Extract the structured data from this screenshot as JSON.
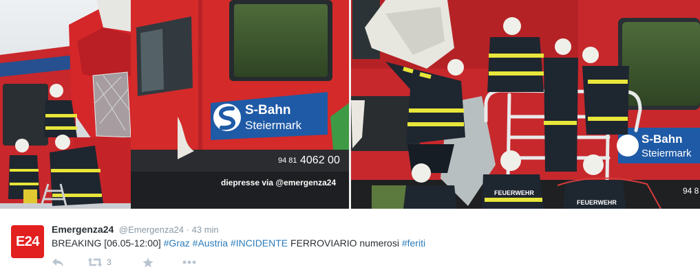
{
  "photo": {
    "left_logo": {
      "brand": "S-Bahn",
      "region": "Steiermark"
    },
    "right_logo": {
      "brand": "S-Bahn",
      "region": "Steiermark"
    },
    "train_number_prefix": "94 81",
    "train_number": "4062 00",
    "right_number_fragment": "94 8",
    "watermark": "diepresse via @emergenza24",
    "vest_label": "FEUERWEHR",
    "colors": {
      "train_red": "#d42a2a",
      "logo_blue": "#1f5aa6",
      "vest": "#1e2630",
      "reflective": "#e8e63a"
    }
  },
  "tweet": {
    "avatar_text": "E24",
    "avatar_color": "#e2201f",
    "display_name": "Emergenza24",
    "handle": "@Emergenza24",
    "separator": "·",
    "time": "43 min",
    "text_prefix": "BREAKING [06.05-12:00] ",
    "tag_graz": "#Graz",
    "tag_austria": "#Austria",
    "tag_incidente": "#INCIDENTE",
    "word_ferroviario": " FERROVIARIO numerosi ",
    "tag_feriti": "#feriti",
    "hashtag_color": "#2b7bb9",
    "actions": {
      "reply_icon": "reply-icon",
      "retweet_icon": "retweet-icon",
      "retweet_count": "3",
      "favorite_icon": "star-icon",
      "more_icon": "more-icon"
    }
  }
}
